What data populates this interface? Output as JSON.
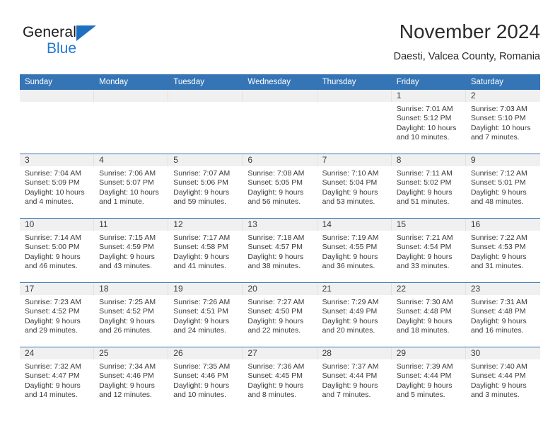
{
  "brand": {
    "name_part1": "General",
    "name_part2": "Blue",
    "accent_color": "#1f7ad6",
    "triangle_color": "#1f6fc0"
  },
  "header": {
    "title": "November 2024",
    "location": "Daesti, Valcea County, Romania"
  },
  "calendar": {
    "header_bg": "#3575b6",
    "daynum_bg": "#f0f0f0",
    "weekdays": [
      "Sunday",
      "Monday",
      "Tuesday",
      "Wednesday",
      "Thursday",
      "Friday",
      "Saturday"
    ],
    "weeks": [
      [
        {
          "day": "",
          "sunrise": "",
          "sunset": "",
          "daylight": "",
          "daylight2": ""
        },
        {
          "day": "",
          "sunrise": "",
          "sunset": "",
          "daylight": "",
          "daylight2": ""
        },
        {
          "day": "",
          "sunrise": "",
          "sunset": "",
          "daylight": "",
          "daylight2": ""
        },
        {
          "day": "",
          "sunrise": "",
          "sunset": "",
          "daylight": "",
          "daylight2": ""
        },
        {
          "day": "",
          "sunrise": "",
          "sunset": "",
          "daylight": "",
          "daylight2": ""
        },
        {
          "day": "1",
          "sunrise": "Sunrise: 7:01 AM",
          "sunset": "Sunset: 5:12 PM",
          "daylight": "Daylight: 10 hours",
          "daylight2": "and 10 minutes."
        },
        {
          "day": "2",
          "sunrise": "Sunrise: 7:03 AM",
          "sunset": "Sunset: 5:10 PM",
          "daylight": "Daylight: 10 hours",
          "daylight2": "and 7 minutes."
        }
      ],
      [
        {
          "day": "3",
          "sunrise": "Sunrise: 7:04 AM",
          "sunset": "Sunset: 5:09 PM",
          "daylight": "Daylight: 10 hours",
          "daylight2": "and 4 minutes."
        },
        {
          "day": "4",
          "sunrise": "Sunrise: 7:06 AM",
          "sunset": "Sunset: 5:07 PM",
          "daylight": "Daylight: 10 hours",
          "daylight2": "and 1 minute."
        },
        {
          "day": "5",
          "sunrise": "Sunrise: 7:07 AM",
          "sunset": "Sunset: 5:06 PM",
          "daylight": "Daylight: 9 hours",
          "daylight2": "and 59 minutes."
        },
        {
          "day": "6",
          "sunrise": "Sunrise: 7:08 AM",
          "sunset": "Sunset: 5:05 PM",
          "daylight": "Daylight: 9 hours",
          "daylight2": "and 56 minutes."
        },
        {
          "day": "7",
          "sunrise": "Sunrise: 7:10 AM",
          "sunset": "Sunset: 5:04 PM",
          "daylight": "Daylight: 9 hours",
          "daylight2": "and 53 minutes."
        },
        {
          "day": "8",
          "sunrise": "Sunrise: 7:11 AM",
          "sunset": "Sunset: 5:02 PM",
          "daylight": "Daylight: 9 hours",
          "daylight2": "and 51 minutes."
        },
        {
          "day": "9",
          "sunrise": "Sunrise: 7:12 AM",
          "sunset": "Sunset: 5:01 PM",
          "daylight": "Daylight: 9 hours",
          "daylight2": "and 48 minutes."
        }
      ],
      [
        {
          "day": "10",
          "sunrise": "Sunrise: 7:14 AM",
          "sunset": "Sunset: 5:00 PM",
          "daylight": "Daylight: 9 hours",
          "daylight2": "and 46 minutes."
        },
        {
          "day": "11",
          "sunrise": "Sunrise: 7:15 AM",
          "sunset": "Sunset: 4:59 PM",
          "daylight": "Daylight: 9 hours",
          "daylight2": "and 43 minutes."
        },
        {
          "day": "12",
          "sunrise": "Sunrise: 7:17 AM",
          "sunset": "Sunset: 4:58 PM",
          "daylight": "Daylight: 9 hours",
          "daylight2": "and 41 minutes."
        },
        {
          "day": "13",
          "sunrise": "Sunrise: 7:18 AM",
          "sunset": "Sunset: 4:57 PM",
          "daylight": "Daylight: 9 hours",
          "daylight2": "and 38 minutes."
        },
        {
          "day": "14",
          "sunrise": "Sunrise: 7:19 AM",
          "sunset": "Sunset: 4:55 PM",
          "daylight": "Daylight: 9 hours",
          "daylight2": "and 36 minutes."
        },
        {
          "day": "15",
          "sunrise": "Sunrise: 7:21 AM",
          "sunset": "Sunset: 4:54 PM",
          "daylight": "Daylight: 9 hours",
          "daylight2": "and 33 minutes."
        },
        {
          "day": "16",
          "sunrise": "Sunrise: 7:22 AM",
          "sunset": "Sunset: 4:53 PM",
          "daylight": "Daylight: 9 hours",
          "daylight2": "and 31 minutes."
        }
      ],
      [
        {
          "day": "17",
          "sunrise": "Sunrise: 7:23 AM",
          "sunset": "Sunset: 4:52 PM",
          "daylight": "Daylight: 9 hours",
          "daylight2": "and 29 minutes."
        },
        {
          "day": "18",
          "sunrise": "Sunrise: 7:25 AM",
          "sunset": "Sunset: 4:52 PM",
          "daylight": "Daylight: 9 hours",
          "daylight2": "and 26 minutes."
        },
        {
          "day": "19",
          "sunrise": "Sunrise: 7:26 AM",
          "sunset": "Sunset: 4:51 PM",
          "daylight": "Daylight: 9 hours",
          "daylight2": "and 24 minutes."
        },
        {
          "day": "20",
          "sunrise": "Sunrise: 7:27 AM",
          "sunset": "Sunset: 4:50 PM",
          "daylight": "Daylight: 9 hours",
          "daylight2": "and 22 minutes."
        },
        {
          "day": "21",
          "sunrise": "Sunrise: 7:29 AM",
          "sunset": "Sunset: 4:49 PM",
          "daylight": "Daylight: 9 hours",
          "daylight2": "and 20 minutes."
        },
        {
          "day": "22",
          "sunrise": "Sunrise: 7:30 AM",
          "sunset": "Sunset: 4:48 PM",
          "daylight": "Daylight: 9 hours",
          "daylight2": "and 18 minutes."
        },
        {
          "day": "23",
          "sunrise": "Sunrise: 7:31 AM",
          "sunset": "Sunset: 4:48 PM",
          "daylight": "Daylight: 9 hours",
          "daylight2": "and 16 minutes."
        }
      ],
      [
        {
          "day": "24",
          "sunrise": "Sunrise: 7:32 AM",
          "sunset": "Sunset: 4:47 PM",
          "daylight": "Daylight: 9 hours",
          "daylight2": "and 14 minutes."
        },
        {
          "day": "25",
          "sunrise": "Sunrise: 7:34 AM",
          "sunset": "Sunset: 4:46 PM",
          "daylight": "Daylight: 9 hours",
          "daylight2": "and 12 minutes."
        },
        {
          "day": "26",
          "sunrise": "Sunrise: 7:35 AM",
          "sunset": "Sunset: 4:46 PM",
          "daylight": "Daylight: 9 hours",
          "daylight2": "and 10 minutes."
        },
        {
          "day": "27",
          "sunrise": "Sunrise: 7:36 AM",
          "sunset": "Sunset: 4:45 PM",
          "daylight": "Daylight: 9 hours",
          "daylight2": "and 8 minutes."
        },
        {
          "day": "28",
          "sunrise": "Sunrise: 7:37 AM",
          "sunset": "Sunset: 4:44 PM",
          "daylight": "Daylight: 9 hours",
          "daylight2": "and 7 minutes."
        },
        {
          "day": "29",
          "sunrise": "Sunrise: 7:39 AM",
          "sunset": "Sunset: 4:44 PM",
          "daylight": "Daylight: 9 hours",
          "daylight2": "and 5 minutes."
        },
        {
          "day": "30",
          "sunrise": "Sunrise: 7:40 AM",
          "sunset": "Sunset: 4:44 PM",
          "daylight": "Daylight: 9 hours",
          "daylight2": "and 3 minutes."
        }
      ]
    ]
  }
}
